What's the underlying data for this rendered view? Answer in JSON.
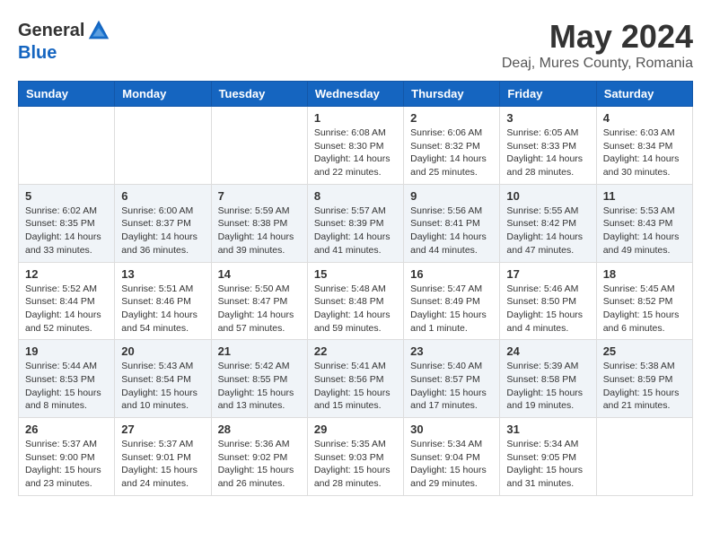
{
  "header": {
    "logo_general": "General",
    "logo_blue": "Blue",
    "title": "May 2024",
    "subtitle": "Deaj, Mures County, Romania"
  },
  "days_of_week": [
    "Sunday",
    "Monday",
    "Tuesday",
    "Wednesday",
    "Thursday",
    "Friday",
    "Saturday"
  ],
  "weeks": [
    [
      {
        "day": "",
        "info": ""
      },
      {
        "day": "",
        "info": ""
      },
      {
        "day": "",
        "info": ""
      },
      {
        "day": "1",
        "info": "Sunrise: 6:08 AM\nSunset: 8:30 PM\nDaylight: 14 hours\nand 22 minutes."
      },
      {
        "day": "2",
        "info": "Sunrise: 6:06 AM\nSunset: 8:32 PM\nDaylight: 14 hours\nand 25 minutes."
      },
      {
        "day": "3",
        "info": "Sunrise: 6:05 AM\nSunset: 8:33 PM\nDaylight: 14 hours\nand 28 minutes."
      },
      {
        "day": "4",
        "info": "Sunrise: 6:03 AM\nSunset: 8:34 PM\nDaylight: 14 hours\nand 30 minutes."
      }
    ],
    [
      {
        "day": "5",
        "info": "Sunrise: 6:02 AM\nSunset: 8:35 PM\nDaylight: 14 hours\nand 33 minutes."
      },
      {
        "day": "6",
        "info": "Sunrise: 6:00 AM\nSunset: 8:37 PM\nDaylight: 14 hours\nand 36 minutes."
      },
      {
        "day": "7",
        "info": "Sunrise: 5:59 AM\nSunset: 8:38 PM\nDaylight: 14 hours\nand 39 minutes."
      },
      {
        "day": "8",
        "info": "Sunrise: 5:57 AM\nSunset: 8:39 PM\nDaylight: 14 hours\nand 41 minutes."
      },
      {
        "day": "9",
        "info": "Sunrise: 5:56 AM\nSunset: 8:41 PM\nDaylight: 14 hours\nand 44 minutes."
      },
      {
        "day": "10",
        "info": "Sunrise: 5:55 AM\nSunset: 8:42 PM\nDaylight: 14 hours\nand 47 minutes."
      },
      {
        "day": "11",
        "info": "Sunrise: 5:53 AM\nSunset: 8:43 PM\nDaylight: 14 hours\nand 49 minutes."
      }
    ],
    [
      {
        "day": "12",
        "info": "Sunrise: 5:52 AM\nSunset: 8:44 PM\nDaylight: 14 hours\nand 52 minutes."
      },
      {
        "day": "13",
        "info": "Sunrise: 5:51 AM\nSunset: 8:46 PM\nDaylight: 14 hours\nand 54 minutes."
      },
      {
        "day": "14",
        "info": "Sunrise: 5:50 AM\nSunset: 8:47 PM\nDaylight: 14 hours\nand 57 minutes."
      },
      {
        "day": "15",
        "info": "Sunrise: 5:48 AM\nSunset: 8:48 PM\nDaylight: 14 hours\nand 59 minutes."
      },
      {
        "day": "16",
        "info": "Sunrise: 5:47 AM\nSunset: 8:49 PM\nDaylight: 15 hours\nand 1 minute."
      },
      {
        "day": "17",
        "info": "Sunrise: 5:46 AM\nSunset: 8:50 PM\nDaylight: 15 hours\nand 4 minutes."
      },
      {
        "day": "18",
        "info": "Sunrise: 5:45 AM\nSunset: 8:52 PM\nDaylight: 15 hours\nand 6 minutes."
      }
    ],
    [
      {
        "day": "19",
        "info": "Sunrise: 5:44 AM\nSunset: 8:53 PM\nDaylight: 15 hours\nand 8 minutes."
      },
      {
        "day": "20",
        "info": "Sunrise: 5:43 AM\nSunset: 8:54 PM\nDaylight: 15 hours\nand 10 minutes."
      },
      {
        "day": "21",
        "info": "Sunrise: 5:42 AM\nSunset: 8:55 PM\nDaylight: 15 hours\nand 13 minutes."
      },
      {
        "day": "22",
        "info": "Sunrise: 5:41 AM\nSunset: 8:56 PM\nDaylight: 15 hours\nand 15 minutes."
      },
      {
        "day": "23",
        "info": "Sunrise: 5:40 AM\nSunset: 8:57 PM\nDaylight: 15 hours\nand 17 minutes."
      },
      {
        "day": "24",
        "info": "Sunrise: 5:39 AM\nSunset: 8:58 PM\nDaylight: 15 hours\nand 19 minutes."
      },
      {
        "day": "25",
        "info": "Sunrise: 5:38 AM\nSunset: 8:59 PM\nDaylight: 15 hours\nand 21 minutes."
      }
    ],
    [
      {
        "day": "26",
        "info": "Sunrise: 5:37 AM\nSunset: 9:00 PM\nDaylight: 15 hours\nand 23 minutes."
      },
      {
        "day": "27",
        "info": "Sunrise: 5:37 AM\nSunset: 9:01 PM\nDaylight: 15 hours\nand 24 minutes."
      },
      {
        "day": "28",
        "info": "Sunrise: 5:36 AM\nSunset: 9:02 PM\nDaylight: 15 hours\nand 26 minutes."
      },
      {
        "day": "29",
        "info": "Sunrise: 5:35 AM\nSunset: 9:03 PM\nDaylight: 15 hours\nand 28 minutes."
      },
      {
        "day": "30",
        "info": "Sunrise: 5:34 AM\nSunset: 9:04 PM\nDaylight: 15 hours\nand 29 minutes."
      },
      {
        "day": "31",
        "info": "Sunrise: 5:34 AM\nSunset: 9:05 PM\nDaylight: 15 hours\nand 31 minutes."
      },
      {
        "day": "",
        "info": ""
      }
    ]
  ]
}
